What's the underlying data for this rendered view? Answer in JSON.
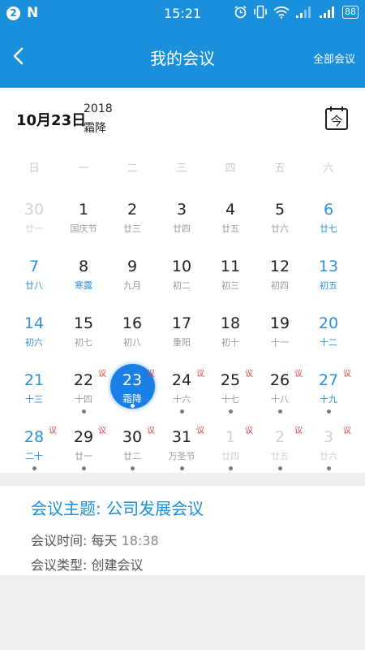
{
  "status_bar": {
    "badge": "2",
    "n_icon": "N",
    "time": "15:21",
    "battery": "88",
    "icons": [
      "alarm-icon",
      "vibrate-icon",
      "wifi-icon",
      "signal-icon",
      "signal-icon"
    ]
  },
  "header": {
    "title": "我的会议",
    "all_meetings": "全部会议",
    "back_icon": "chevron-left-icon"
  },
  "date_header": {
    "date": "10月23日",
    "year": "2018",
    "solar_term": "霜降",
    "today_button": "今"
  },
  "weekdays": [
    "日",
    "一",
    "二",
    "三",
    "四",
    "五",
    "六"
  ],
  "weeks": [
    [
      {
        "day": "30",
        "sub": "廿一",
        "other": true
      },
      {
        "day": "1",
        "sub": "国庆节"
      },
      {
        "day": "2",
        "sub": "廿三"
      },
      {
        "day": "3",
        "sub": "廿四"
      },
      {
        "day": "4",
        "sub": "廿五"
      },
      {
        "day": "5",
        "sub": "廿六"
      },
      {
        "day": "6",
        "sub": "廿七"
      }
    ],
    [
      {
        "day": "7",
        "sub": "廿八"
      },
      {
        "day": "8",
        "sub": "寒露",
        "term": true
      },
      {
        "day": "9",
        "sub": "九月"
      },
      {
        "day": "10",
        "sub": "初二"
      },
      {
        "day": "11",
        "sub": "初三"
      },
      {
        "day": "12",
        "sub": "初四"
      },
      {
        "day": "13",
        "sub": "初五"
      }
    ],
    [
      {
        "day": "14",
        "sub": "初六"
      },
      {
        "day": "15",
        "sub": "初七"
      },
      {
        "day": "16",
        "sub": "初八"
      },
      {
        "day": "17",
        "sub": "重阳"
      },
      {
        "day": "18",
        "sub": "初十"
      },
      {
        "day": "19",
        "sub": "十一"
      },
      {
        "day": "20",
        "sub": "十二"
      }
    ],
    [
      {
        "day": "21",
        "sub": "十三"
      },
      {
        "day": "22",
        "sub": "十四",
        "tag": "议",
        "dot": true
      },
      {
        "day": "23",
        "sub": "霜降",
        "tag": "议",
        "dot": true,
        "selected": true
      },
      {
        "day": "24",
        "sub": "十六",
        "tag": "议",
        "dot": true
      },
      {
        "day": "25",
        "sub": "十七",
        "tag": "议",
        "dot": true
      },
      {
        "day": "26",
        "sub": "十八",
        "tag": "议",
        "dot": true
      },
      {
        "day": "27",
        "sub": "十九",
        "tag": "议",
        "dot": true
      }
    ],
    [
      {
        "day": "28",
        "sub": "二十",
        "tag": "议",
        "dot": true
      },
      {
        "day": "29",
        "sub": "廿一",
        "tag": "议",
        "dot": true
      },
      {
        "day": "30",
        "sub": "廿二",
        "tag": "议",
        "dot": true
      },
      {
        "day": "31",
        "sub": "万圣节",
        "tag": "议",
        "dot": true
      },
      {
        "day": "1",
        "sub": "廿四",
        "tag": "议",
        "dot": true,
        "other": true
      },
      {
        "day": "2",
        "sub": "廿五",
        "tag": "议",
        "dot": true,
        "other": true
      },
      {
        "day": "3",
        "sub": "廿六",
        "tag": "议",
        "dot": true,
        "other": true
      }
    ]
  ],
  "meeting": {
    "topic_label": "会议主题:",
    "topic": "公司发展会议",
    "time_label": "会议时间:",
    "time_freq": "每天",
    "time_value": "18:38",
    "type_label": "会议类型:",
    "type_value": "创建会议"
  },
  "colors": {
    "primary": "#1a8fdc",
    "weekend": "#2e90e0",
    "selected": "#1a7fe6",
    "meeting_tag": "#e04040"
  }
}
